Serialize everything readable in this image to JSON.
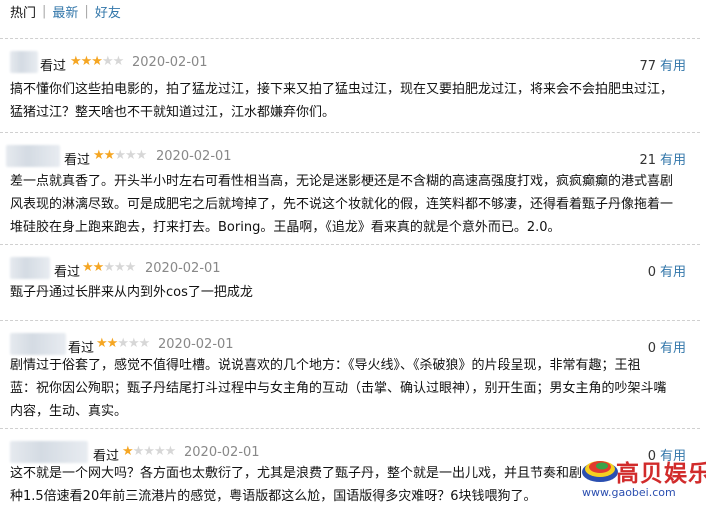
{
  "tabs": [
    "热门",
    "最新",
    "好友"
  ],
  "tab_separator": "|",
  "seen_label": "看过",
  "useful_label": "有用",
  "colors": {
    "star_on": "#f5a623",
    "star_off": "#d7d7d7",
    "link": "#37a",
    "logo_red": "#d12b2b",
    "logo_blue": "#2b4fb0"
  },
  "reviews": [
    {
      "rating": 3,
      "stars": {
        "on": "★★★",
        "off": "★★"
      },
      "date": "2020-02-01",
      "useful": "77",
      "lines": [
        "搞不懂你们这些拍电影的，拍了猛龙过江，接下来又拍了猛虫过江，现在又要拍肥龙过江，将来会不会拍肥虫过江，",
        "猛猪过江？整天啥也不干就知道过江，江水都嫌弃你们。"
      ]
    },
    {
      "rating": 2,
      "stars": {
        "on": "★★",
        "off": "★★★"
      },
      "date": "2020-02-01",
      "useful": "21",
      "lines": [
        "差一点就真香了。开头半小时左右可看性相当高，无论是迷影梗还是不含糊的高速高强度打戏，疯疯癫癫的港式喜剧",
        "风表现的淋漓尽致。可是成肥宅之后就垮掉了，先不说这个妆就化的假，连笑料都不够凄，还得看着甄子丹像拖着一",
        "堆硅胶在身上跑来跑去，打来打去。Boring。王晶啊，《追龙》看来真的就是个意外而已。2.0。"
      ]
    },
    {
      "rating": 2,
      "stars": {
        "on": "★★",
        "off": "★★★"
      },
      "date": "2020-02-01",
      "useful": "0",
      "lines": [
        "甄子丹通过长胖来从内到外cos了一把成龙"
      ]
    },
    {
      "rating": 2,
      "stars": {
        "on": "★★",
        "off": "★★★"
      },
      "date": "2020-02-01",
      "useful": "0",
      "lines": [
        "剧情过于俗套了，感觉不值得吐槽。说说喜欢的几个地方：《导火线》、《杀破狼》的片段呈现，非常有趣；王祖",
        "蓝：祝你因公殉职；甄子丹结尾打斗过程中与女主角的互动（击掌、确认过眼神），别开生面；男女主角的吵架斗嘴",
        "内容，生动、真实。"
      ]
    },
    {
      "rating": 1,
      "stars": {
        "on": "★",
        "off": "★★★★"
      },
      "date": "2020-02-01",
      "useful": "0",
      "lines": [
        "这不就是一个网大吗？各方面也太敷衍了，尤其是浪费了甄子丹，整个就是一出儿戏，并且节奏和剧",
        "种1.5倍速看20年前三流港片的感觉，粤语版都这么尬，国语版得多灾难呀？6块钱喂狗了。"
      ]
    }
  ],
  "watermark": {
    "name": "高贝娱乐",
    "url": "www.gaobei.com"
  }
}
